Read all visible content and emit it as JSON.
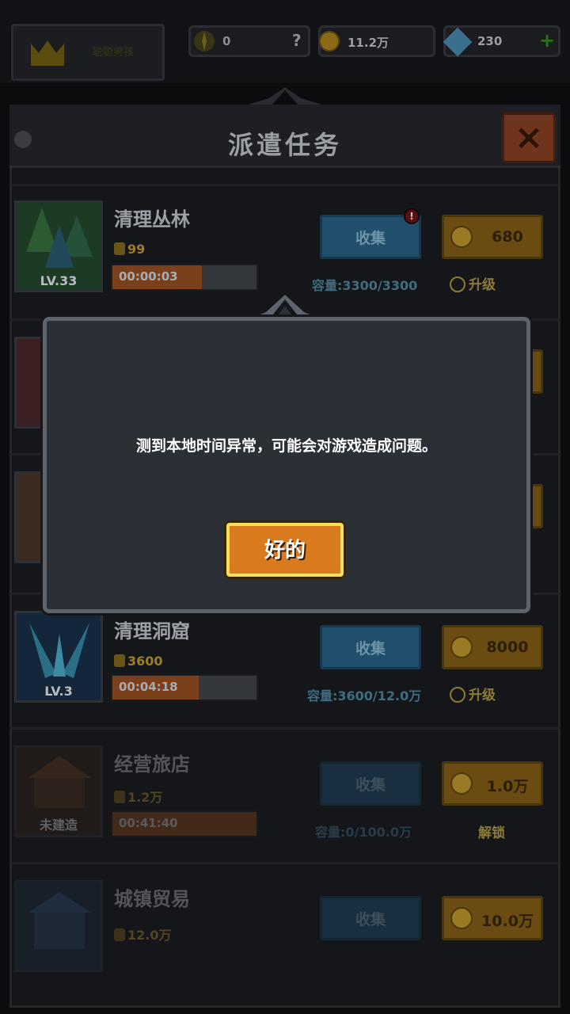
{
  "topbar": {
    "crown_label": "聪聪男孩",
    "compass_value": "0",
    "compass_hint": "?",
    "gold": "11.2万",
    "gems": "230",
    "add": "+"
  },
  "panel": {
    "title": "派遣任务",
    "close": "×"
  },
  "missions": [
    {
      "title": "清理丛林",
      "level": "LV.33",
      "reward": "99",
      "timer": "00:00:03",
      "progress": 0.62,
      "collect": "收集",
      "cost": "680",
      "capacity": "容量:3300/3300",
      "upgrade": "升级",
      "alert": "!"
    },
    {
      "title": "清理洞窟",
      "level": "LV.3",
      "reward": "3600",
      "timer": "00:04:18",
      "progress": 0.6,
      "collect": "收集",
      "cost": "8000",
      "capacity": "容量:3600/12.0万",
      "upgrade": "升级"
    },
    {
      "title": "经营旅店",
      "level": "未建造",
      "reward": "1.2万",
      "timer": "00:41:40",
      "progress": 1.0,
      "collect": "收集",
      "cost": "1.0万",
      "capacity": "容量:0/100.0万",
      "upgrade": "解锁"
    },
    {
      "title": "城镇贸易",
      "reward": "12.0万",
      "collect": "收集",
      "cost": "10.0万"
    }
  ],
  "dialog": {
    "message": "测到本地时间异常，可能会对游戏造成问题。",
    "ok_label": "好的"
  }
}
